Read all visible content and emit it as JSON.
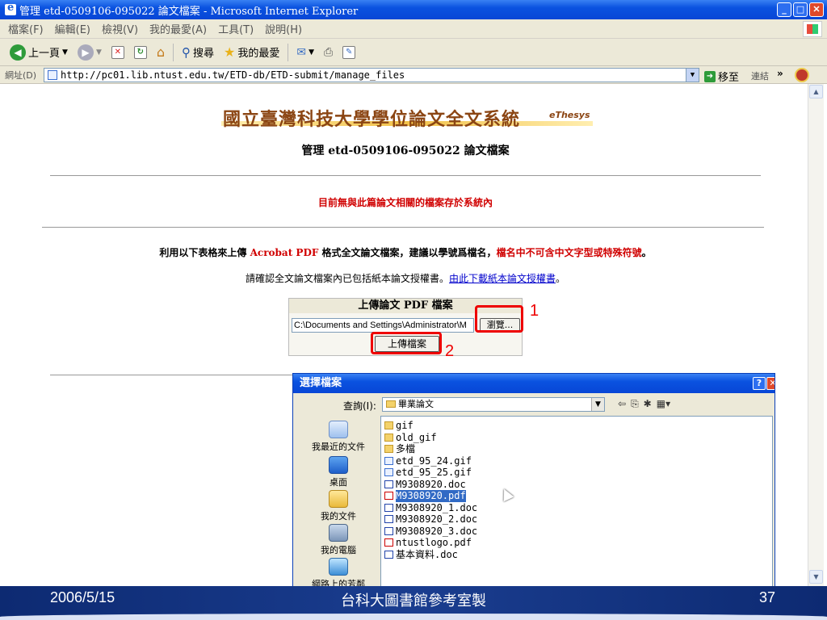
{
  "window": {
    "title": "管理 etd-0509106-095022 論文檔案 - Microsoft Internet Explorer",
    "minimize": "_",
    "maximize": "□",
    "close": "✕"
  },
  "menu": [
    "檔案(F)",
    "編輯(E)",
    "檢視(V)",
    "我的最愛(A)",
    "工具(T)",
    "說明(H)"
  ],
  "toolbar": {
    "back": "上一頁",
    "search": "搜尋",
    "favorites": "我的最愛"
  },
  "address": {
    "label": "網址(D)",
    "url": "http://pc01.lib.ntust.edu.tw/ETD-db/ETD-submit/manage_files",
    "go": "移至",
    "links": "連結",
    "more": "»"
  },
  "page": {
    "site_title": "國立臺灣科技大學學位論文全文系統",
    "site_brand": "eThesys",
    "heading": "管理 etd-0509106-095022 論文檔案",
    "notice": "目前無與此篇論文相關的檔案存於系統內",
    "instr_a": "利用以下表格來上傳 ",
    "instr_b": "Acrobat PDF",
    "instr_c": " 格式全文論文檔案，建議以學號爲檔名，",
    "instr_d": "檔名中不可含中文字型或特殊符號",
    "instr_e": "。",
    "confirm_text": "請確認全文論文檔案內已包括紙本論文授權書。",
    "confirm_link": "由此下載紙本論文授權書",
    "confirm_end": "。",
    "upload_header": "上傳論文 PDF 檔案",
    "file_value": "C:\\Documents and Settings\\Administrator\\M",
    "browse": "瀏覽...",
    "upload": "上傳檔案",
    "marker1": "1",
    "marker2": "2"
  },
  "dialog": {
    "title": "選擇檔案",
    "help": "?",
    "close": "✕",
    "lookin_label": "查詢(I):",
    "lookin_value": "畢業論文",
    "places": [
      "我最近的文件",
      "桌面",
      "我的文件",
      "我的電腦",
      "網路上的芳鄰"
    ],
    "files": [
      {
        "name": "gif",
        "type": "folder"
      },
      {
        "name": "old_gif",
        "type": "folder"
      },
      {
        "name": "多檔",
        "type": "folder"
      },
      {
        "name": "etd_95_24.gif",
        "type": "gif"
      },
      {
        "name": "etd_95_25.gif",
        "type": "gif"
      },
      {
        "name": "M9308920.doc",
        "type": "doc"
      },
      {
        "name": "M9308920.pdf",
        "type": "pdf",
        "selected": true
      },
      {
        "name": "M9308920_1.doc",
        "type": "doc"
      },
      {
        "name": "M9308920_2.doc",
        "type": "doc"
      },
      {
        "name": "M9308920_3.doc",
        "type": "doc"
      },
      {
        "name": "ntustlogo.pdf",
        "type": "pdf"
      },
      {
        "name": "基本資料.doc",
        "type": "doc"
      }
    ]
  },
  "footer": {
    "date": "2006/5/15",
    "center": "台科大圖書館參考室製",
    "page": "37"
  },
  "colors": {
    "title_blue": "#0a52e0",
    "alert_red": "#d00000",
    "site_brown": "#8b4513",
    "highlight_red": "#ee0000",
    "footer_navy": "#1a3d8f"
  }
}
